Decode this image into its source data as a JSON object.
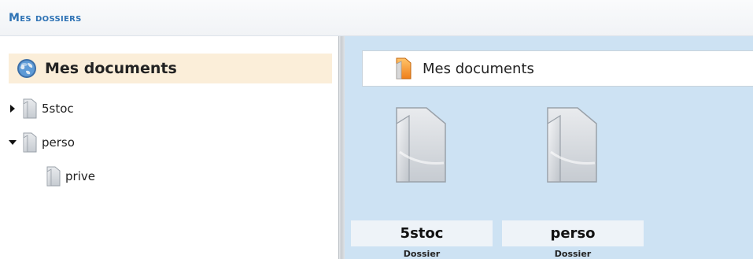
{
  "header": {
    "title": "Mes dossiers"
  },
  "tree": {
    "root": {
      "label": "Mes documents",
      "icon": "globe-icon"
    },
    "items": [
      {
        "label": "5stoc",
        "expanded": false,
        "icon": "folder-icon"
      },
      {
        "label": "perso",
        "expanded": true,
        "icon": "folder-icon"
      },
      {
        "label": "prive",
        "icon": "folder-icon"
      }
    ]
  },
  "content": {
    "path_label": "Mes documents",
    "path_icon": "orange-folder-icon",
    "files": [
      {
        "name": "5stoc",
        "type": "Dossier"
      },
      {
        "name": "perso",
        "type": "Dossier"
      }
    ]
  },
  "colors": {
    "header_title": "#2f73b5",
    "root_highlight": "#fbeed9",
    "content_bg": "#cde2f3",
    "path_icon_accent": "#f39a2a"
  }
}
